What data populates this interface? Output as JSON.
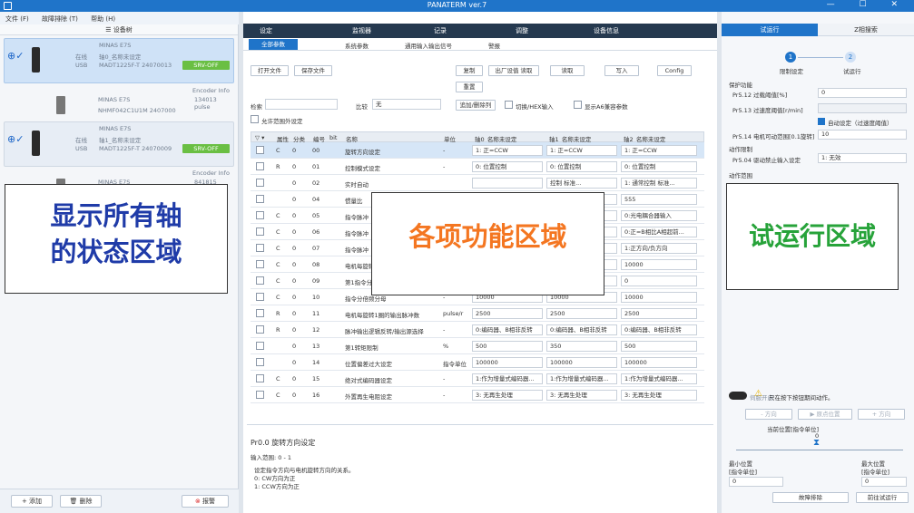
{
  "window": {
    "title": "PANATERM ver.7",
    "controls": "— ☐ ✕"
  },
  "menu": [
    "文件 (F)",
    "故障排除 (T)",
    "帮助 (H)"
  ],
  "left": {
    "header": "设备树",
    "axes": [
      {
        "model": "MINAS E7S",
        "status": "在线",
        "name": "轴0_名称未设定",
        "conn": "USB",
        "part": "MADT1225F-T 24070013",
        "servo": "SRV-OFF",
        "enc_title": "Encoder Info",
        "enc_val": "134013 pulse",
        "motor": "MINAS E7S",
        "motor_part": "NHMF042C1U1M 2407000"
      },
      {
        "model": "MINAS E7S",
        "status": "在线",
        "name": "轴1_名称未设定",
        "conn": "USB",
        "part": "MADT1225F-T 24070009",
        "servo": "SRV-OFF",
        "enc_title": "Encoder Info",
        "enc_val": "841815 pulse",
        "motor": "MINAS E7S",
        "motor_part": ""
      }
    ],
    "add": "+ 添加",
    "delete": "删除",
    "alarm": "报警"
  },
  "overlays": {
    "left": "显示所有轴\n的状态区域",
    "center": "各项功能区域",
    "right": "试运行区域",
    "left_color": "#1f3ba8",
    "center_color": "#f47621",
    "right_color": "#27a33a"
  },
  "center": {
    "tabs": [
      "设定",
      "监视器",
      "记录",
      "调整",
      "设备信息"
    ],
    "subtabs": [
      "全部参数",
      "系统参数",
      "通用输入输出信号",
      "警报"
    ],
    "buttons": {
      "open": "打开文件",
      "save": "保存文件",
      "copy": "复制",
      "factory": "出厂设值 读取",
      "read": "读取",
      "write": "写入",
      "config": "Config",
      "reset": "重置",
      "addrm": "追加/删除列",
      "hex": "切换/HEX输入",
      "a6": "显示A6兼容参数"
    },
    "search_label": "检索",
    "compare_label": "比较",
    "compare_val": "无",
    "onlydiff": "允许范围外设定",
    "cols": [
      "属性",
      "分类",
      "编号",
      "bit",
      "名称",
      "单位",
      "轴0_名称未设定",
      "轴1_名称未设定",
      "轴2_名称未设定"
    ],
    "rows": [
      {
        "attr": "C",
        "cls": "0",
        "no": "00",
        "name": "旋转方向设定",
        "unit": "-",
        "v0": "1: 正=CCW",
        "v1": "1: 正=CCW",
        "v2": "1: 正=CCW"
      },
      {
        "attr": "R",
        "cls": "0",
        "no": "01",
        "name": "控制模式设定",
        "unit": "-",
        "v0": "0: 位置控制",
        "v1": "0: 位置控制",
        "v2": "0: 位置控制"
      },
      {
        "attr": "",
        "cls": "0",
        "no": "02",
        "name": "实时自动",
        "unit": "",
        "v0": "",
        "v1": "控制 标准...",
        "v2": "1: 通常控制 标准..."
      },
      {
        "attr": "",
        "cls": "0",
        "no": "04",
        "name": "惯量比",
        "unit": "",
        "v0": "",
        "v1": "",
        "v2": "555"
      },
      {
        "attr": "C",
        "cls": "0",
        "no": "05",
        "name": "指令脉冲",
        "unit": "",
        "v0": "",
        "v1": "输入",
        "v2": "0:光电耦合器输入"
      },
      {
        "attr": "C",
        "cls": "0",
        "no": "06",
        "name": "指令脉冲",
        "unit": "",
        "v0": "",
        "v1": "(A相超前...",
        "v2": "0:正=B相比A相超前..."
      },
      {
        "attr": "C",
        "cls": "0",
        "no": "07",
        "name": "指令脉冲",
        "unit": "",
        "v0": "",
        "v1": "",
        "v2": "1:正方向/负方向"
      },
      {
        "attr": "C",
        "cls": "0",
        "no": "08",
        "name": "电机每旋转",
        "unit": "",
        "v0": "",
        "v1": "",
        "v2": "10000"
      },
      {
        "attr": "C",
        "cls": "0",
        "no": "09",
        "name": "第1指令分倍频分子",
        "unit": "",
        "v0": "0",
        "v1": "0",
        "v2": "0"
      },
      {
        "attr": "C",
        "cls": "0",
        "no": "10",
        "name": "指令分倍频分母",
        "unit": "-",
        "v0": "10000",
        "v1": "10000",
        "v2": "10000"
      },
      {
        "attr": "R",
        "cls": "0",
        "no": "11",
        "name": "电机每旋转1圈的输出脉冲数",
        "unit": "pulse/r",
        "v0": "2500",
        "v1": "2500",
        "v2": "2500"
      },
      {
        "attr": "R",
        "cls": "0",
        "no": "12",
        "name": "脉冲输出逻辑反转/输出源选择",
        "unit": "-",
        "v0": "0:编码器、B相非反转",
        "v1": "0:编码器、B相非反转",
        "v2": "0:编码器、B相非反转"
      },
      {
        "attr": "",
        "cls": "0",
        "no": "13",
        "name": "第1转矩限制",
        "unit": "%",
        "v0": "500",
        "v1": "350",
        "v2": "500"
      },
      {
        "attr": "",
        "cls": "0",
        "no": "14",
        "name": "位置偏差过大设定",
        "unit": "指令单位",
        "v0": "100000",
        "v1": "100000",
        "v2": "100000"
      },
      {
        "attr": "C",
        "cls": "0",
        "no": "15",
        "name": "绝对式编码器设定",
        "unit": "-",
        "v0": "1:作为增量式编码器...",
        "v1": "1:作为增量式编码器...",
        "v2": "1:作为增量式编码器..."
      },
      {
        "attr": "C",
        "cls": "0",
        "no": "16",
        "name": "外置再生电阻设定",
        "unit": "-",
        "v0": "3: 无再生处理",
        "v1": "3: 无再生处理",
        "v2": "3: 无再生处理"
      }
    ],
    "desc": {
      "title": "Pr0.0 旋转方向设定",
      "range": "输入范围: 0 - 1",
      "line1": "设定指令方向与电机旋转方向的关系。",
      "line2": "0: CW方向为正",
      "line3": "1: CCW方向为正"
    }
  },
  "right": {
    "tab_on": "试运行",
    "tab_off": "Z相搜索",
    "step1": "1",
    "step2": "2",
    "step1_label": "限制设定",
    "step2_label": "试运行",
    "protect": "保护功能",
    "p512": "Pr5.12 过载阈值[%]",
    "p512v": "0",
    "p513": "Pr5.13 过速度阈值[r/min]",
    "p513v": "",
    "auto": "自动设定（过速度阈值）",
    "p514": "Pr5.14 电机可动范围[0.1旋转]",
    "p514v": "10",
    "motion": "动作限制",
    "p504": "Pr5.04 驱动禁止输入设定",
    "p504v": "1: 无效",
    "range": "动作范围",
    "enable": "伺服开启",
    "warn": "只在按下按钮期间动作。",
    "fwd": "- 方向",
    "back": "▶ 原点位置",
    "rev": "+ 方向",
    "curpos": "当前位置[指令单位]",
    "curpos_v": "0",
    "min": "最小位置",
    "minu": "[指令单位]",
    "minv": "0",
    "max": "最大位置",
    "maxu": "[指令单位]",
    "maxv": "0",
    "trouble": "故障排除",
    "goto": "前往试运行"
  }
}
